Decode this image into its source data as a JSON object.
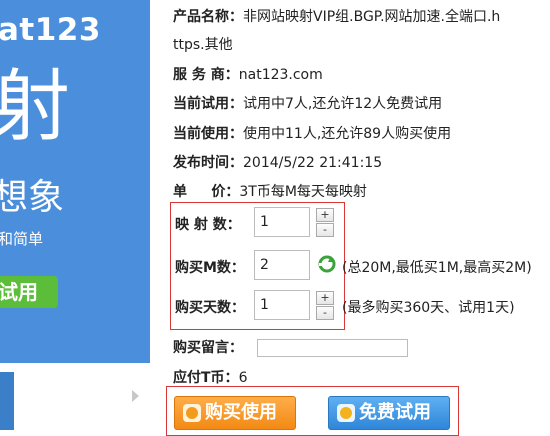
{
  "banner": {
    "brand": "at123",
    "big_char": "射",
    "mid_char": "想象",
    "small_text": "和简单",
    "trial_tab": "试用"
  },
  "product": {
    "name_label": "产品名称：",
    "name_value_line1": "非网站映射VIP组.BGP.网站加速.全端口.h",
    "name_value_line2": "ttps.其他",
    "vendor_label": "服 务 商：",
    "vendor_value": "nat123.com",
    "trial_label": "当前试用：",
    "trial_value": "试用中7人,还允许12人免费试用",
    "usage_label": "当前使用：",
    "usage_value": "使用中11人,还允许89人购买使用",
    "published_label": "发布时间：",
    "published_value": "2014/5/22 21:41:15",
    "price_label": "单     价：",
    "price_value": "3T币每M每天每映射"
  },
  "order": {
    "mapping_label": "映 射 数：",
    "mapping_value": "1",
    "bandwidth_label": "购买M数：",
    "bandwidth_value": "2",
    "bandwidth_hint": "(总20M,最低买1M,最高买2M)",
    "days_label": "购买天数：",
    "days_value": "1",
    "days_hint": "(最多购买360天、试用1天)",
    "message_label": "购买留言：",
    "message_value": "",
    "cost_label": "应付T币：",
    "cost_value": "6",
    "plus": "+",
    "minus": "-"
  },
  "buttons": {
    "buy_label": "购买使用",
    "trial_label": "免费试用"
  },
  "colors": {
    "banner_blue": "#4b8fdc",
    "trial_green": "#5bbd3a",
    "highlight_red": "#d93636",
    "buy_orange": "#f28a14",
    "trial_blue": "#2f86d8"
  },
  "icons": {
    "refresh": "refresh-icon",
    "buy": "coin-icon",
    "trial": "gift-icon"
  }
}
